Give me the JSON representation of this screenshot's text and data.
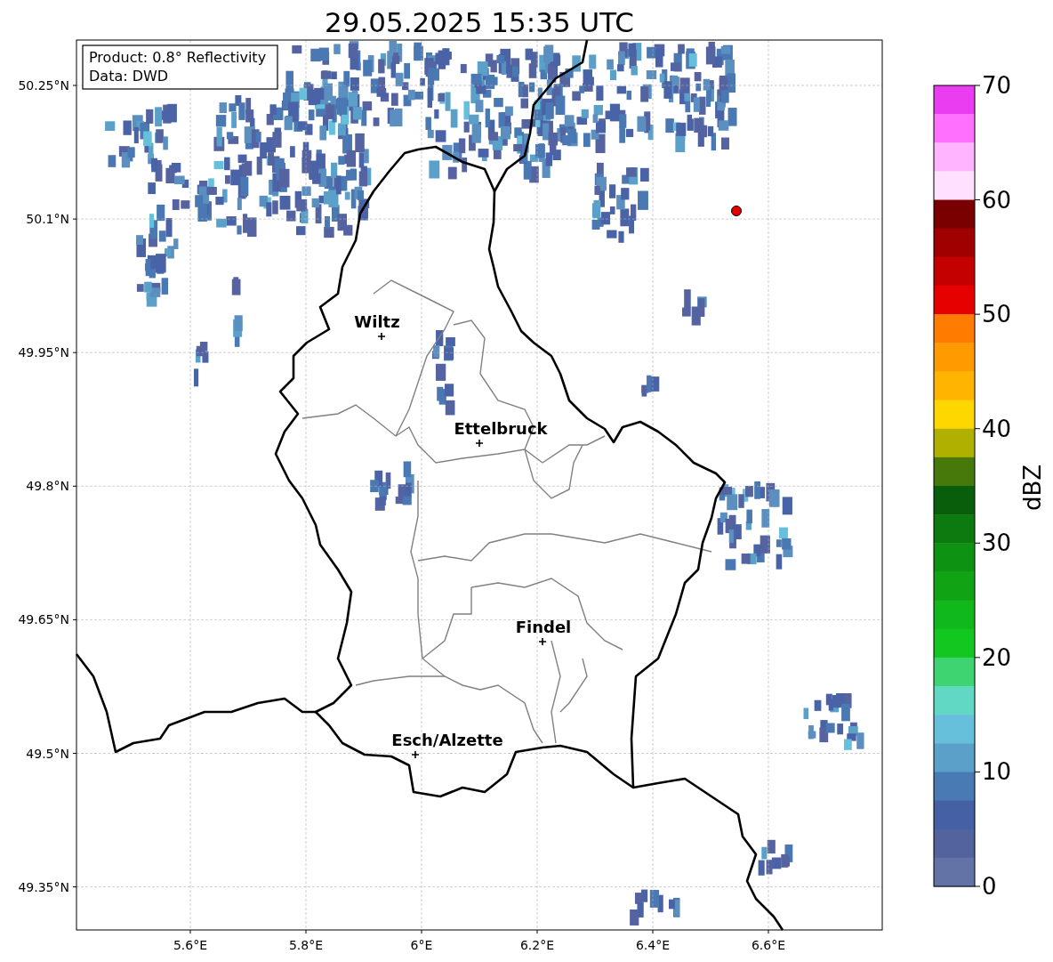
{
  "title": "29.05.2025 15:35 UTC",
  "info_box": [
    "Product: 0.8° Reflectivity",
    "Data: DWD"
  ],
  "map": {
    "lat_ticks": [
      "50.25°N",
      "50.1°N",
      "49.95°N",
      "49.8°N",
      "49.65°N",
      "49.5°N",
      "49.35°N"
    ],
    "lon_ticks": [
      "5.6°E",
      "5.8°E",
      "6°E",
      "6.2°E",
      "6.4°E",
      "6.6°E"
    ],
    "cities": [
      {
        "name": "Wiltz"
      },
      {
        "name": "Ettelbruck"
      },
      {
        "name": "Findel"
      },
      {
        "name": "Esch/Alzette"
      }
    ]
  },
  "colorbar": {
    "label": "dBZ",
    "ticks": [
      "70",
      "60",
      "50",
      "40",
      "30",
      "20",
      "10",
      "0"
    ],
    "segments": [
      {
        "color": "#ea3cf0"
      },
      {
        "color": "#ff70ff"
      },
      {
        "color": "#ffb4ff"
      },
      {
        "color": "#ffe0ff"
      },
      {
        "color": "#7a0000"
      },
      {
        "color": "#a00000"
      },
      {
        "color": "#c40000"
      },
      {
        "color": "#e60000"
      },
      {
        "color": "#ff7c00"
      },
      {
        "color": "#ff9a00"
      },
      {
        "color": "#ffb400"
      },
      {
        "color": "#ffd700"
      },
      {
        "color": "#b0b000"
      },
      {
        "color": "#46780a"
      },
      {
        "color": "#085e0a"
      },
      {
        "color": "#0c7a0e"
      },
      {
        "color": "#0e9212"
      },
      {
        "color": "#10a414"
      },
      {
        "color": "#10b81c"
      },
      {
        "color": "#12c820"
      },
      {
        "color": "#3ed472"
      },
      {
        "color": "#60d8c4"
      },
      {
        "color": "#66c0dc"
      },
      {
        "color": "#5aa0c8"
      },
      {
        "color": "#4a7ab4"
      },
      {
        "color": "#4560a4"
      },
      {
        "color": "#53639e"
      },
      {
        "color": "#6473a6"
      }
    ]
  }
}
